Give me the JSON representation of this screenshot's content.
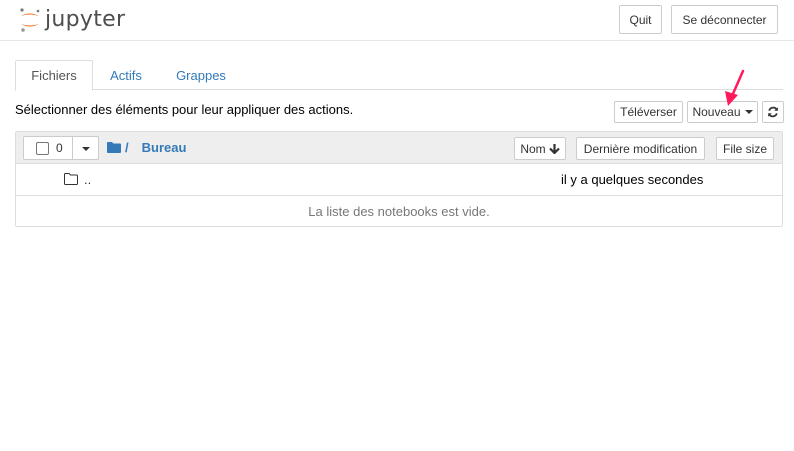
{
  "header": {
    "logo_text": "jupyter",
    "quit_label": "Quit",
    "logout_label": "Se déconnecter"
  },
  "tabs": [
    {
      "label": "Fichiers",
      "active": true
    },
    {
      "label": "Actifs",
      "active": false
    },
    {
      "label": "Grappes",
      "active": false
    }
  ],
  "toolbar": {
    "instructions": "Sélectionner des éléments pour leur appliquer des actions.",
    "upload_label": "Téléverser",
    "new_label": "Nouveau"
  },
  "list_header": {
    "selected_count": "0",
    "breadcrumb_sep": "/",
    "breadcrumb_current": "Bureau",
    "sort_name_label": "Nom",
    "sort_modified_label": "Dernière modification",
    "sort_size_label": "File size"
  },
  "rows": [
    {
      "name": "..",
      "modified": "il y a quelques secondes"
    }
  ],
  "empty_message": "La liste des notebooks est vide.",
  "colors": {
    "link": "#337ab7",
    "annotation_arrow": "#ff1a5e",
    "logo_orange": "#f37726"
  }
}
